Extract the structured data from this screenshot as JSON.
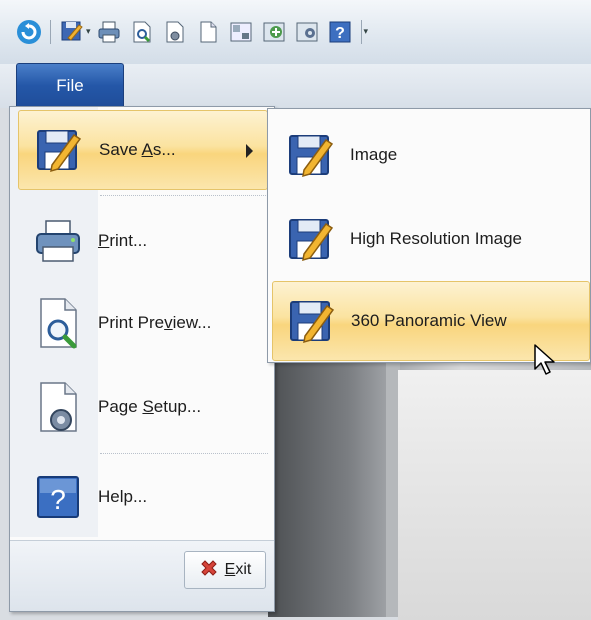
{
  "toolbar": {
    "icons": [
      "app-orb-icon",
      "save-as-icon",
      "print-icon",
      "print-preview-icon",
      "page-setup-icon",
      "new-doc-icon",
      "view-icon",
      "render-icon",
      "settings-icon",
      "help-icon"
    ]
  },
  "file_button": {
    "label": "File"
  },
  "menu": {
    "items": [
      {
        "pre": "Save ",
        "key": "A",
        "post": "s...",
        "icon": "save-as-icon",
        "has_submenu": true
      },
      {
        "pre": "",
        "key": "P",
        "post": "rint...",
        "icon": "printer-icon"
      },
      {
        "pre": "Print Pre",
        "key": "v",
        "post": "iew...",
        "icon": "print-preview-icon"
      },
      {
        "pre": "Page ",
        "key": "S",
        "post": "etup...",
        "icon": "page-setup-icon"
      },
      {
        "pre": "Help...",
        "key": "",
        "post": "",
        "icon": "help-icon"
      }
    ],
    "exit": {
      "pre": "",
      "key": "E",
      "post": "xit",
      "icon": "exit-icon"
    }
  },
  "submenu": {
    "items": [
      {
        "label": "Image",
        "icon": "save-image-icon"
      },
      {
        "label": "High Resolution Image",
        "icon": "save-hires-icon"
      },
      {
        "label": "360 Panoramic View",
        "icon": "save-panorama-icon"
      }
    ]
  },
  "colors": {
    "accent": "#2457a8",
    "highlight": "#f9d57d"
  }
}
